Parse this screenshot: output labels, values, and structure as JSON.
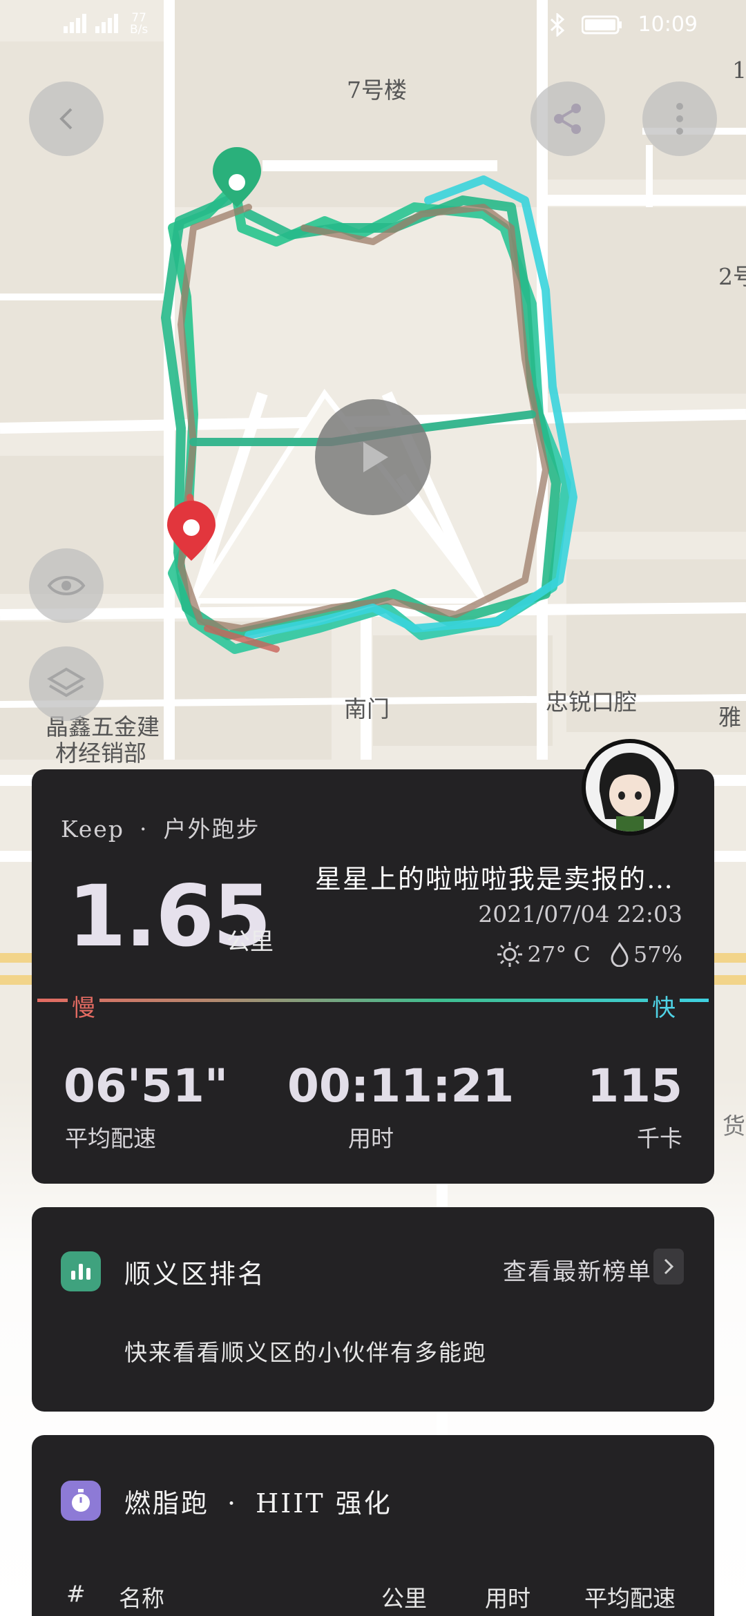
{
  "status_bar": {
    "speed": "77",
    "speed_unit": "B/s",
    "time": "10:09"
  },
  "map": {
    "labels": {
      "building_7": "7号楼",
      "building_2": "2号",
      "building_1": "1",
      "south_gate": "南门",
      "dental": "忠锐口腔",
      "hardware_line1": "晶鑫五金建",
      "hardware_line2": "材经销部",
      "ya": "雅",
      "huo": "货"
    },
    "route_colors": {
      "slow": "#e36b62",
      "mid": "#3fbf90",
      "fast": "#3fd0e0"
    }
  },
  "buttons": {
    "back_icon": "chevron-left-icon",
    "share_icon": "share-icon",
    "more_icon": "more-vertical-icon",
    "play_icon": "play-icon",
    "eye_icon": "eye-icon",
    "layers_icon": "layers-icon"
  },
  "summary": {
    "source": "Keep",
    "separator": "·",
    "activity": "户外跑步",
    "distance": "1.65",
    "distance_unit": "公里",
    "username": "星星上的啦啦啦我是卖报的…",
    "datetime": "2021/07/04  22:03",
    "temperature": "27°  C",
    "humidity": "57%",
    "slow_label": "慢",
    "fast_label": "快",
    "stats": [
      {
        "value": "06'51\"",
        "label": "平均配速"
      },
      {
        "value": "00:11:21",
        "label": "用时"
      },
      {
        "value": "115",
        "label": "千卡"
      }
    ]
  },
  "rank": {
    "title": "顺义区排名",
    "link": "查看最新榜单",
    "description": "快来看看顺义区的小伙伴有多能跑",
    "accent": "#3fa27e"
  },
  "training": {
    "title_part1": "燃脂跑",
    "separator": "·",
    "title_part2": "HIIT  强化",
    "accent": "#8d7ad6",
    "columns": [
      "#",
      "名称",
      "公里",
      "用时",
      "平均配速"
    ]
  }
}
